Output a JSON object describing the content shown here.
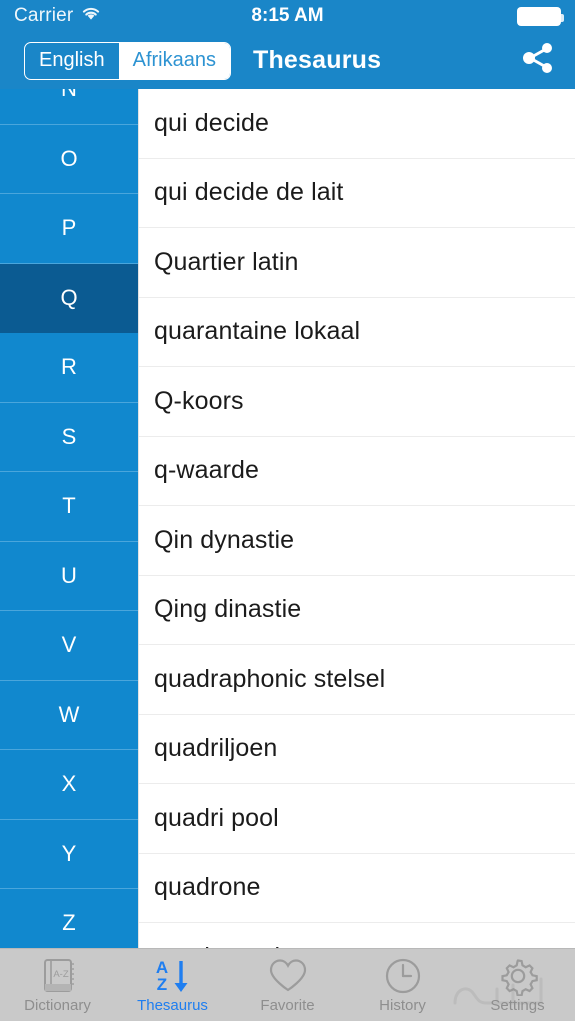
{
  "status_bar": {
    "carrier": "Carrier",
    "wifi_icon": "wifi-icon",
    "time": "8:15 AM",
    "battery_icon": "battery-full-icon"
  },
  "nav_bar": {
    "title": "Thesaurus",
    "share_icon": "share-icon",
    "language_segments": [
      {
        "label": "English",
        "selected": false
      },
      {
        "label": "Afrikaans",
        "selected": true
      }
    ]
  },
  "alphabet_index": {
    "active_letter": "Q",
    "letters": [
      "N",
      "O",
      "P",
      "Q",
      "R",
      "S",
      "T",
      "U",
      "V",
      "W",
      "X",
      "Y",
      "Z"
    ]
  },
  "word_list": {
    "items": [
      "qui decide",
      "qui decide de lait",
      "Quartier latin",
      "quarantaine lokaal",
      "Q-koors",
      "q-waarde",
      "Qin dynastie",
      "Qing dinastie",
      "quadraphonic stelsel",
      "quadriljoen",
      "quadri pool",
      "quadrone",
      "quadrupool"
    ]
  },
  "tab_bar": {
    "tabs": [
      {
        "label": "Dictionary",
        "icon": "dictionary-book-icon",
        "active": false
      },
      {
        "label": "Thesaurus",
        "icon": "a-z-sort-icon",
        "active": true
      },
      {
        "label": "Favorite",
        "icon": "heart-icon",
        "active": false
      },
      {
        "label": "History",
        "icon": "clock-icon",
        "active": false
      },
      {
        "label": "Settings",
        "icon": "gear-icon",
        "active": false
      }
    ]
  },
  "colors": {
    "nav_blue": "#1a86c8",
    "sidebar_blue": "#1188ce",
    "sidebar_active_blue": "#0b5b92",
    "tabbar_gray": "#c9c9c9",
    "tab_active_blue": "#1f7ef0",
    "list_text": "#1b1b1b"
  }
}
